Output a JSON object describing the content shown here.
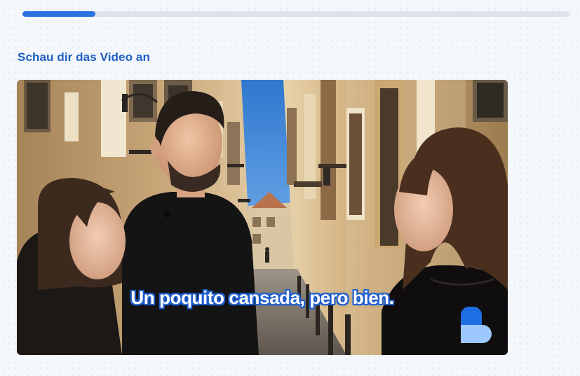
{
  "progress": {
    "fraction": 0.133,
    "track_color": "#dce3ec",
    "fill_color": "#2a73de"
  },
  "instruction": {
    "text": "Schau dir das Video an",
    "color": "#1d5fc1"
  },
  "video": {
    "subtitle": "Un poquito cansada, pero bien.",
    "subtitle_outline_color": "#1f5fd0",
    "scene": "narrow-street-three-people",
    "logo_icon": "babbel-logo-icon",
    "logo_colors": [
      "#1e6fe4",
      "#9cc7ff"
    ]
  }
}
